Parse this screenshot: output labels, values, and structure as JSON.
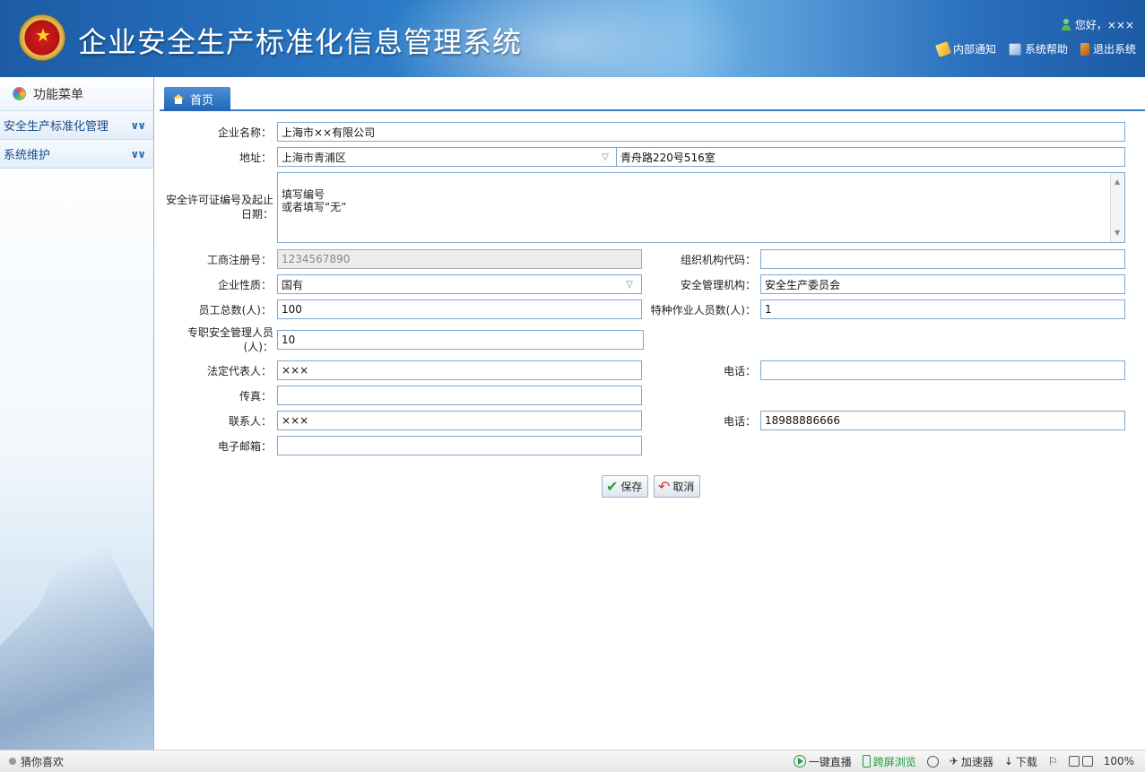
{
  "app": {
    "title": "企业安全生产标准化信息管理系统"
  },
  "header": {
    "greeting": "您好，×××",
    "links": [
      {
        "label": "内部通知",
        "icon": "notice-icon"
      },
      {
        "label": "系统帮助",
        "icon": "help-icon"
      },
      {
        "label": "退出系统",
        "icon": "exit-icon"
      }
    ]
  },
  "sidebar": {
    "title": "功能菜单",
    "items": [
      {
        "label": "安全生产标准化管理"
      },
      {
        "label": "系统维护"
      }
    ]
  },
  "tabs": [
    {
      "label": "首页"
    }
  ],
  "form": {
    "company_name": {
      "label": "企业名称：",
      "value": "上海市××有限公司"
    },
    "address": {
      "label": "地址：",
      "district": "上海市青浦区",
      "detail": "青舟路220号516室"
    },
    "license": {
      "label": "安全许可证编号及起止日期：",
      "value": "填写编号\n或者填写“无”"
    },
    "business_reg": {
      "label": "工商注册号：",
      "value": "1234567890"
    },
    "org_code": {
      "label": "组织机构代码：",
      "value": ""
    },
    "nature": {
      "label": "企业性质：",
      "value": "国有"
    },
    "safety_org": {
      "label": "安全管理机构：",
      "value": "安全生产委员会"
    },
    "employees": {
      "label": "员工总数(人)：",
      "value": "100"
    },
    "special_workers": {
      "label": "特种作业人员数(人)：",
      "value": "1"
    },
    "safety_staff": {
      "label": "专职安全管理人员(人)：",
      "value": "10"
    },
    "legal_rep": {
      "label": "法定代表人：",
      "value": "×××"
    },
    "legal_phone": {
      "label": "电话：",
      "value": ""
    },
    "fax": {
      "label": "传真：",
      "value": ""
    },
    "contact": {
      "label": "联系人：",
      "value": "×××"
    },
    "contact_phone": {
      "label": "电话：",
      "value": "18988886666"
    },
    "email": {
      "label": "电子邮箱：",
      "value": ""
    },
    "save_label": "保存",
    "cancel_label": "取消"
  },
  "statusbar": {
    "left": "猜你喜欢",
    "items": [
      {
        "label": "一键直播"
      },
      {
        "label": "跨屏浏览"
      },
      {
        "label": "加速器"
      },
      {
        "label": "下载"
      }
    ],
    "zoom": "100%"
  }
}
